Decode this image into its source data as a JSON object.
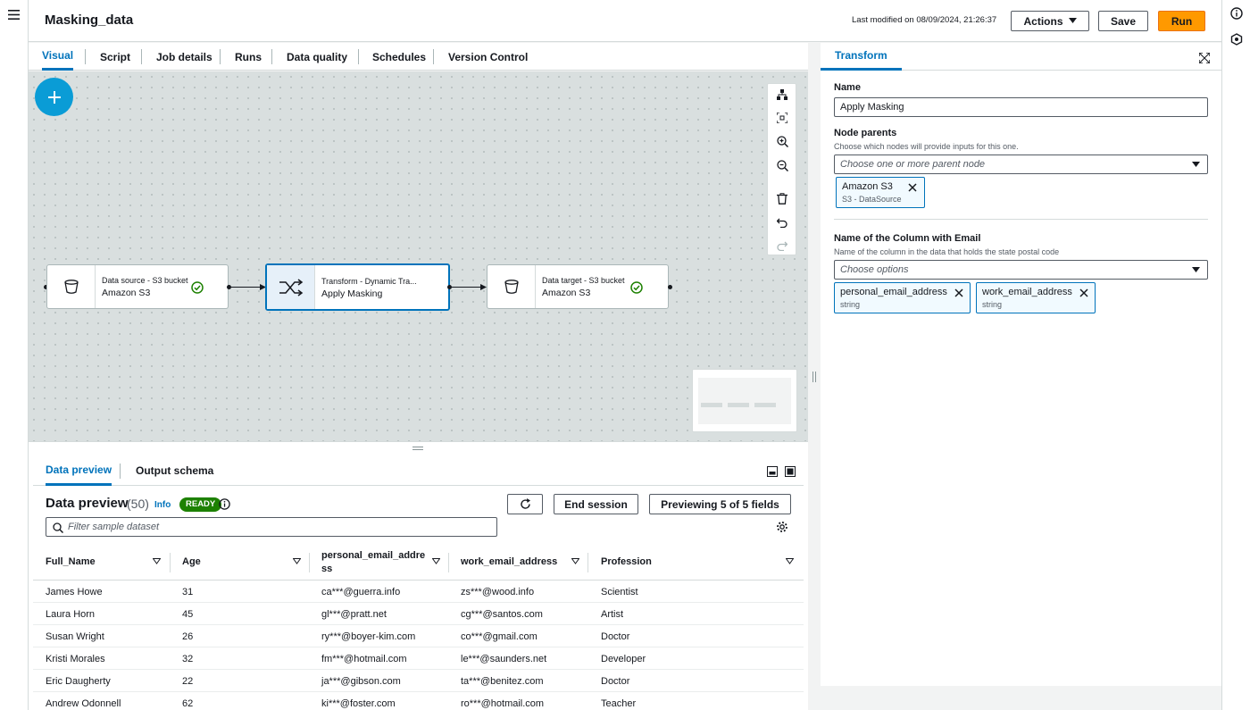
{
  "header": {
    "title": "Masking_data",
    "last_modified": "Last modified on 08/09/2024, 21:26:37",
    "actions_label": "Actions",
    "save_label": "Save",
    "run_label": "Run"
  },
  "tabs": [
    "Visual",
    "Script",
    "Job details",
    "Runs",
    "Data quality",
    "Schedules",
    "Version Control"
  ],
  "canvas": {
    "nodes": [
      {
        "sub": "Data source - S3 bucket",
        "main": "Amazon S3",
        "icon": "bucket-icon",
        "status": "check-icon"
      },
      {
        "sub": "Transform - Dynamic Tra...",
        "main": "Apply Masking",
        "icon": "shuffle-icon"
      },
      {
        "sub": "Data target - S3 bucket",
        "main": "Amazon S3",
        "icon": "bucket-icon",
        "status": "check-icon"
      }
    ]
  },
  "bottom": {
    "tabs": [
      "Data preview",
      "Output schema"
    ],
    "title": "Data preview",
    "count": "(50)",
    "info": "Info",
    "status": "READY",
    "end_session": "End session",
    "previewing": "Previewing 5 of 5 fields",
    "filter_placeholder": "Filter sample dataset",
    "columns": [
      "Full_Name",
      "Age",
      "personal_email_address",
      "work_email_address",
      "Profession"
    ],
    "rows": [
      [
        "James Howe",
        "31",
        "ca***@guerra.info",
        "zs***@wood.info",
        "Scientist"
      ],
      [
        "Laura Horn",
        "45",
        "gl***@pratt.net",
        "cg***@santos.com",
        "Artist"
      ],
      [
        "Susan Wright",
        "26",
        "ry***@boyer-kim.com",
        "co***@gmail.com",
        "Doctor"
      ],
      [
        "Kristi Morales",
        "32",
        "fm***@hotmail.com",
        "le***@saunders.net",
        "Developer"
      ],
      [
        "Eric Daugherty",
        "22",
        "ja***@gibson.com",
        "ta***@benitez.com",
        "Doctor"
      ],
      [
        "Andrew Odonnell",
        "62",
        "ki***@foster.com",
        "ro***@hotmail.com",
        "Teacher"
      ]
    ]
  },
  "panel": {
    "tab": "Transform",
    "name_label": "Name",
    "name_value": "Apply Masking",
    "parents_label": "Node parents",
    "parents_hint": "Choose which nodes will provide inputs for this one.",
    "parents_placeholder": "Choose one or more parent node",
    "parent_token": {
      "main": "Amazon S3",
      "sub": "S3 - DataSource"
    },
    "email_label": "Name of the Column with Email",
    "email_hint": "Name of the column in the data that holds the state postal code",
    "email_placeholder": "Choose options",
    "email_tokens": [
      {
        "main": "personal_email_address",
        "sub": "string"
      },
      {
        "main": "work_email_address",
        "sub": "string"
      }
    ]
  },
  "colors": {
    "accent": "#0073bb",
    "run": "#ff9900",
    "ready": "#1d8102"
  }
}
